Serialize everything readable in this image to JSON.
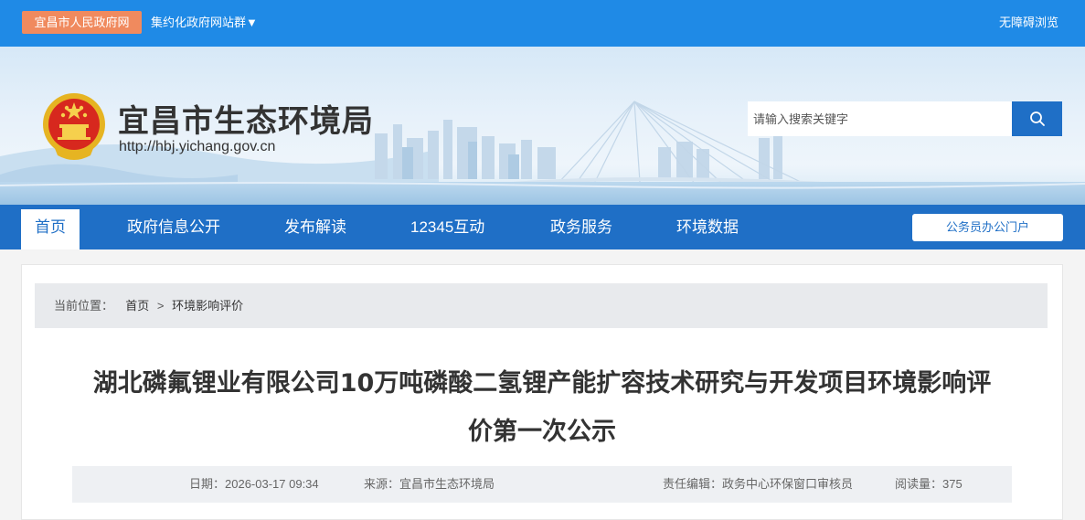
{
  "topbar": {
    "gov_link": "宜昌市人民政府网",
    "cluster": "集约化政府网站群▼",
    "accessibility": "无障碍浏览"
  },
  "banner": {
    "title": "宜昌市生态环境局",
    "url": "http://hbj.yichang.gov.cn",
    "search_placeholder": "请输入搜索关键字"
  },
  "nav": {
    "items": [
      "首页",
      "政府信息公开",
      "发布解读",
      "12345互动",
      "政务服务",
      "环境数据"
    ],
    "portal": "公务员办公门户"
  },
  "breadcrumb": {
    "label": "当前位置：",
    "home": "首页",
    "separator": ">",
    "current": "环境影响评价"
  },
  "article": {
    "title_line1": "湖北磷氟锂业有限公司10万吨磷酸二氢锂产能扩容技术研究与开发项目环境影响评",
    "title_line2": "价第一次公示",
    "date": "日期：2026-03-17 09:34",
    "source": "来源：宜昌市生态环境局",
    "editor": "责任编辑：政务中心环保窗口审核员",
    "views": "阅读量：375"
  },
  "colors": {
    "topbar": "#1f8ae6",
    "nav": "#1f6fc6",
    "gov_link": "#f08a5e"
  }
}
